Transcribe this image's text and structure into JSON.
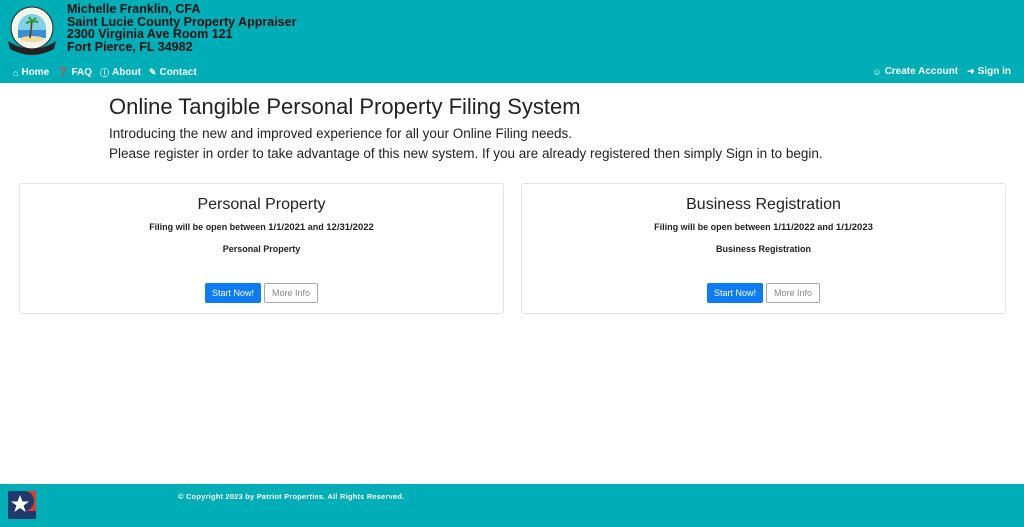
{
  "header": {
    "org_lines": [
      "Michelle Franklin, CFA",
      "Saint Lucie County Property Appraiser",
      "2300 Virginia Ave Room 121",
      "Fort Pierce, FL 34982"
    ],
    "logo_alt": "Saint Lucie County Property Appraiser seal",
    "nav_left": [
      {
        "icon": "home-icon",
        "glyph": "⌂",
        "label": "Home"
      },
      {
        "icon": "question-circle-icon",
        "glyph": "❓",
        "label": "FAQ"
      },
      {
        "icon": "info-circle-icon",
        "glyph": "ⓘ",
        "label": "About"
      },
      {
        "icon": "pencil-icon",
        "glyph": "✎",
        "label": "Contact"
      }
    ],
    "nav_right": [
      {
        "icon": "user-icon",
        "glyph": "☺",
        "label": "Create Account"
      },
      {
        "icon": "sign-in-icon",
        "glyph": "➜",
        "label": "Sign in"
      }
    ]
  },
  "main": {
    "title": "Online Tangible Personal Property Filing System",
    "intro_lines": [
      "Introducing the new and improved experience for all your Online Filing needs.",
      "Please register in order to take advantage of this new system. If you are already registered then simply Sign in to begin."
    ],
    "cards": [
      {
        "title": "Personal Property",
        "dates_prefix": "Filing will be open between",
        "start_date": "1/1/2021",
        "and": "and",
        "end_date": "12/31/2022",
        "subtitle": "Personal Property",
        "start_label": "Start Now!",
        "info_label": "More Info"
      },
      {
        "title": "Business Registration",
        "dates_prefix": "Filing will be open between",
        "start_date": "1/11/2022",
        "and": "and",
        "end_date": "1/1/2023",
        "subtitle": "Business Registration",
        "start_label": "Start Now!",
        "info_label": "More Info"
      }
    ]
  },
  "footer": {
    "copyright": "© Copyright 2023 by Patriot Properties. All Rights Reserved."
  },
  "colors": {
    "brand_teal": "#00aeb8",
    "primary_button": "#0d7cf2"
  }
}
